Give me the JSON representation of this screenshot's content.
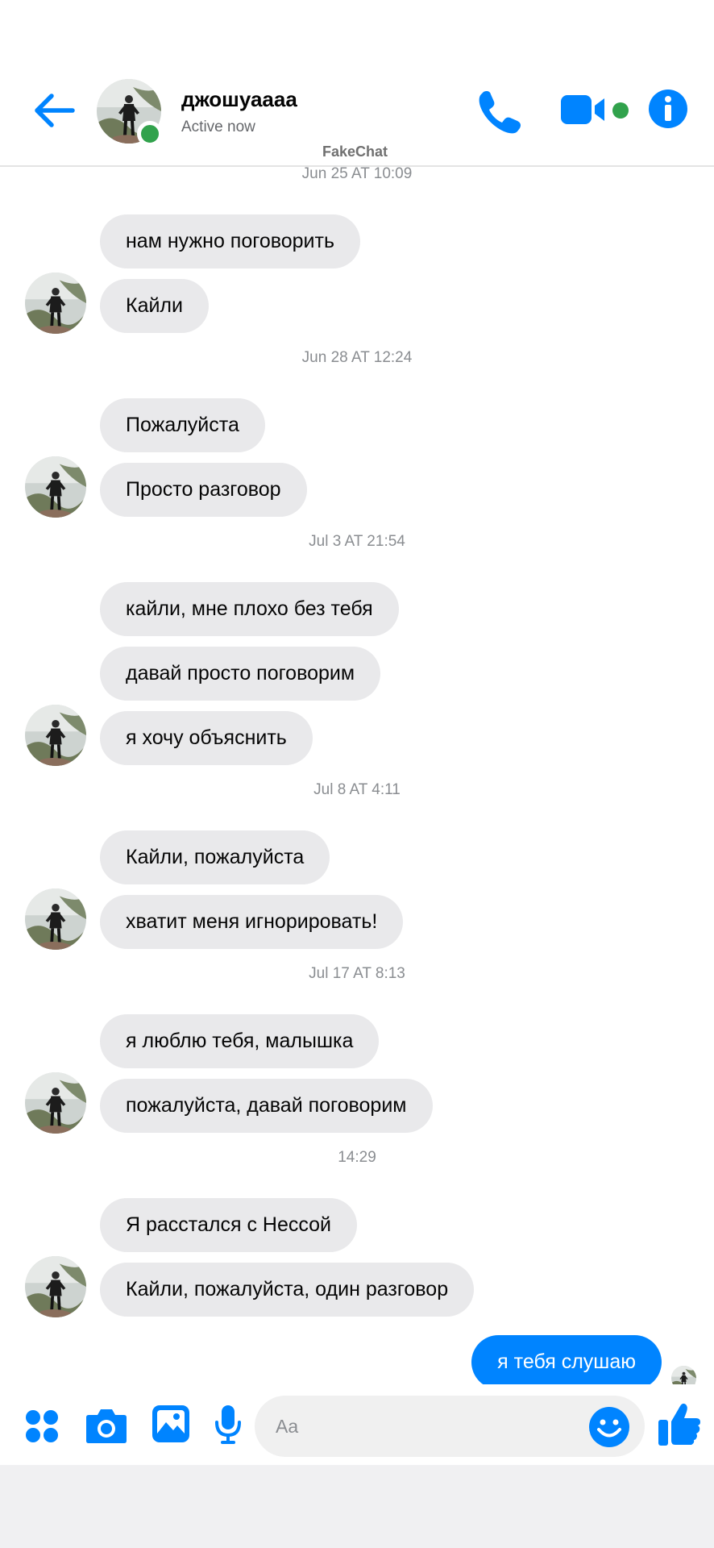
{
  "header": {
    "contact_name": "джошуаааа",
    "status": "Active now",
    "app_name": "FakeChat"
  },
  "conversation": [
    {
      "timestamp": "Jun 25 AT 10:09",
      "messages": []
    },
    {
      "timestamp": "",
      "messages": [
        "нам нужно поговорить",
        "Кайли"
      ]
    },
    {
      "timestamp": "Jun 28 AT 12:24",
      "messages": [
        "Пожалуйста",
        "Просто разговор"
      ]
    },
    {
      "timestamp": "Jul 3 AT 21:54",
      "messages": [
        "кайли, мне плохо без тебя",
        "давай просто поговорим",
        "я хочу объяснить"
      ]
    },
    {
      "timestamp": "Jul 8 AT 4:11",
      "messages": [
        "Кайли, пожалуйста",
        "хватит меня игнорировать!"
      ]
    },
    {
      "timestamp": "Jul 17 AT 8:13",
      "messages": [
        "я люблю тебя, малышка",
        "пожалуйста, давай поговорим"
      ]
    },
    {
      "timestamp": "14:29",
      "messages": [
        "Я расстался с Нессой",
        "Кайли, пожалуйста, один разговор"
      ]
    }
  ],
  "outgoing": {
    "text": "я тебя слушаю"
  },
  "composer": {
    "placeholder": "Aa"
  },
  "colors": {
    "accent": "#0084ff",
    "incoming_bubble": "#e9e9eb",
    "presence": "#31a24c"
  },
  "icons": [
    "back-arrow-icon",
    "phone-icon",
    "video-camera-icon",
    "info-icon",
    "apps-icon",
    "camera-icon",
    "gallery-icon",
    "microphone-icon",
    "emoji-icon",
    "thumbs-up-icon"
  ]
}
